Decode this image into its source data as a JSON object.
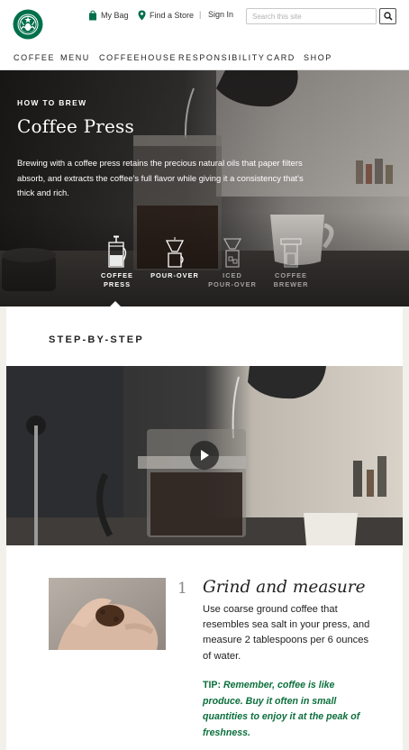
{
  "header": {
    "my_bag": "My Bag",
    "find_store": "Find a Store",
    "separator": "|",
    "sign_in": "Sign In",
    "search_placeholder": "Search this site"
  },
  "nav": [
    "COFFEE",
    "MENU",
    "COFFEEHOUSE",
    "RESPONSIBILITY",
    "CARD",
    "SHOP"
  ],
  "hero": {
    "kicker": "HOW TO BREW",
    "title": "Coffee Press",
    "description": "Brewing with a coffee press retains the precious natural oils that paper filters absorb, and extracts the coffee's full flavor while giving it a consistency that's thick and rich.",
    "methods": [
      {
        "label_line1": "COFFEE",
        "label_line2": "PRESS",
        "icon": "coffee-press-icon",
        "selected": true
      },
      {
        "label_line1": "POUR-OVER",
        "label_line2": "",
        "icon": "pour-over-icon",
        "selected": false
      },
      {
        "label_line1": "ICED",
        "label_line2": "POUR-OVER",
        "icon": "iced-pour-over-icon",
        "selected": false
      },
      {
        "label_line1": "COFFEE",
        "label_line2": "BREWER",
        "icon": "coffee-brewer-icon",
        "selected": false
      }
    ]
  },
  "content": {
    "section_heading": "STEP-BY-STEP",
    "steps": [
      {
        "number": "1",
        "title": "Grind and measure",
        "text": "Use coarse ground coffee that resembles sea salt in your press, and measure 2 tablespoons per 6 ounces of water.",
        "tip_label": "TIP:",
        "tip_text": "Remember, coffee is like produce. Buy it often in small quantities to enjoy it at the peak of freshness."
      }
    ]
  },
  "colors": {
    "brand_green": "#00704a",
    "tip_green": "#0b6f3c",
    "page_bg": "#f2f0eb"
  }
}
